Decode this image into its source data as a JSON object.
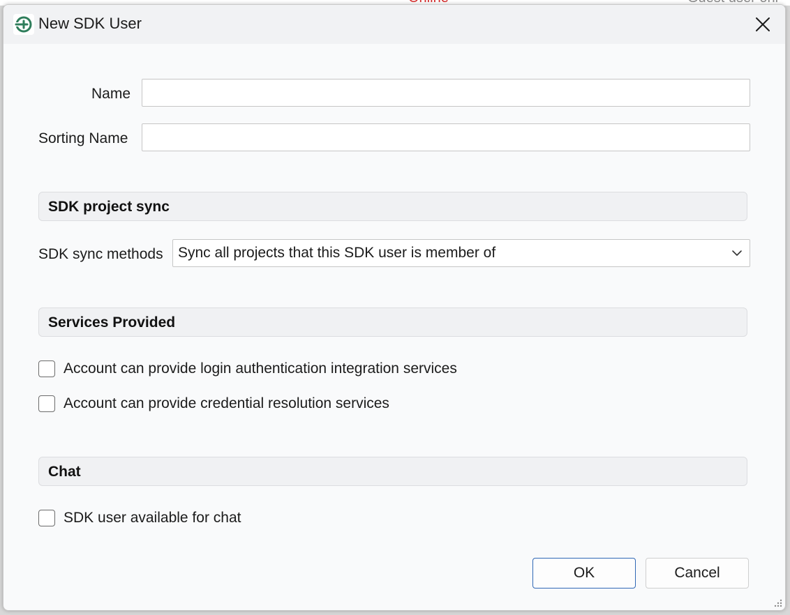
{
  "background": {
    "status_text": "Online",
    "user_text": "Guest user onl"
  },
  "dialog": {
    "title": "New SDK User",
    "close_icon": "close-icon",
    "app_icon": "app-logo-icon"
  },
  "form": {
    "name_label": "Name",
    "name_value": "",
    "sorting_name_label": "Sorting Name",
    "sorting_name_value": ""
  },
  "sync_section": {
    "header": "SDK project sync",
    "methods_label": "SDK sync methods",
    "methods_value": "Sync all projects that this SDK user is member of"
  },
  "services_section": {
    "header": "Services Provided",
    "options": [
      {
        "label": "Account can provide login authentication integration services",
        "checked": false
      },
      {
        "label": "Account can provide credential resolution services",
        "checked": false
      }
    ]
  },
  "chat_section": {
    "header": "Chat",
    "options": [
      {
        "label": "SDK user available for chat",
        "checked": false
      }
    ]
  },
  "buttons": {
    "ok": "OK",
    "cancel": "Cancel"
  },
  "colors": {
    "accent": "#2f67b5",
    "logo_green": "#2e7d5b",
    "status_red": "#d62b2b"
  }
}
